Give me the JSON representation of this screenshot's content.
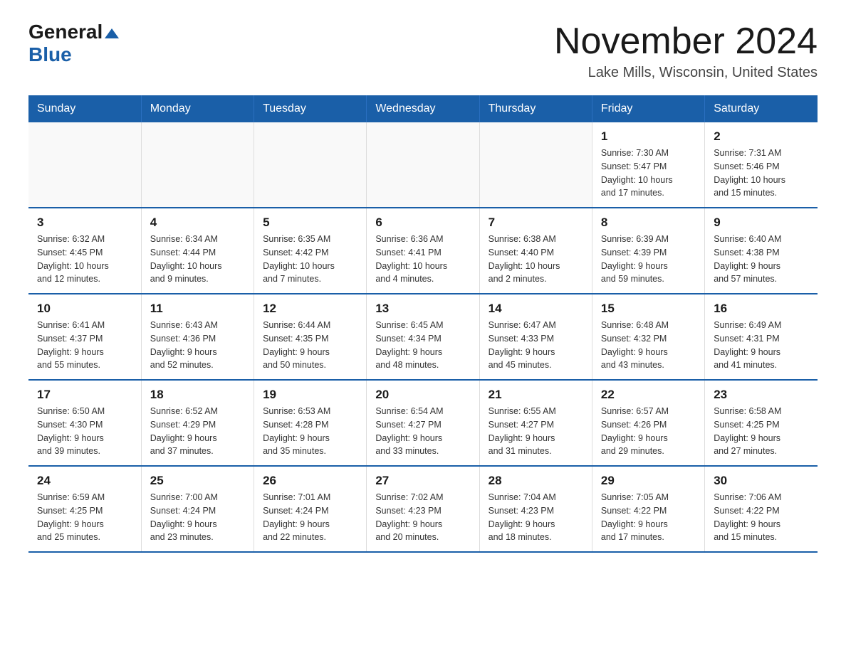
{
  "header": {
    "logo_general": "General",
    "logo_blue": "Blue",
    "month_title": "November 2024",
    "location": "Lake Mills, Wisconsin, United States"
  },
  "weekdays": [
    "Sunday",
    "Monday",
    "Tuesday",
    "Wednesday",
    "Thursday",
    "Friday",
    "Saturday"
  ],
  "weeks": [
    [
      {
        "day": "",
        "info": ""
      },
      {
        "day": "",
        "info": ""
      },
      {
        "day": "",
        "info": ""
      },
      {
        "day": "",
        "info": ""
      },
      {
        "day": "",
        "info": ""
      },
      {
        "day": "1",
        "info": "Sunrise: 7:30 AM\nSunset: 5:47 PM\nDaylight: 10 hours\nand 17 minutes."
      },
      {
        "day": "2",
        "info": "Sunrise: 7:31 AM\nSunset: 5:46 PM\nDaylight: 10 hours\nand 15 minutes."
      }
    ],
    [
      {
        "day": "3",
        "info": "Sunrise: 6:32 AM\nSunset: 4:45 PM\nDaylight: 10 hours\nand 12 minutes."
      },
      {
        "day": "4",
        "info": "Sunrise: 6:34 AM\nSunset: 4:44 PM\nDaylight: 10 hours\nand 9 minutes."
      },
      {
        "day": "5",
        "info": "Sunrise: 6:35 AM\nSunset: 4:42 PM\nDaylight: 10 hours\nand 7 minutes."
      },
      {
        "day": "6",
        "info": "Sunrise: 6:36 AM\nSunset: 4:41 PM\nDaylight: 10 hours\nand 4 minutes."
      },
      {
        "day": "7",
        "info": "Sunrise: 6:38 AM\nSunset: 4:40 PM\nDaylight: 10 hours\nand 2 minutes."
      },
      {
        "day": "8",
        "info": "Sunrise: 6:39 AM\nSunset: 4:39 PM\nDaylight: 9 hours\nand 59 minutes."
      },
      {
        "day": "9",
        "info": "Sunrise: 6:40 AM\nSunset: 4:38 PM\nDaylight: 9 hours\nand 57 minutes."
      }
    ],
    [
      {
        "day": "10",
        "info": "Sunrise: 6:41 AM\nSunset: 4:37 PM\nDaylight: 9 hours\nand 55 minutes."
      },
      {
        "day": "11",
        "info": "Sunrise: 6:43 AM\nSunset: 4:36 PM\nDaylight: 9 hours\nand 52 minutes."
      },
      {
        "day": "12",
        "info": "Sunrise: 6:44 AM\nSunset: 4:35 PM\nDaylight: 9 hours\nand 50 minutes."
      },
      {
        "day": "13",
        "info": "Sunrise: 6:45 AM\nSunset: 4:34 PM\nDaylight: 9 hours\nand 48 minutes."
      },
      {
        "day": "14",
        "info": "Sunrise: 6:47 AM\nSunset: 4:33 PM\nDaylight: 9 hours\nand 45 minutes."
      },
      {
        "day": "15",
        "info": "Sunrise: 6:48 AM\nSunset: 4:32 PM\nDaylight: 9 hours\nand 43 minutes."
      },
      {
        "day": "16",
        "info": "Sunrise: 6:49 AM\nSunset: 4:31 PM\nDaylight: 9 hours\nand 41 minutes."
      }
    ],
    [
      {
        "day": "17",
        "info": "Sunrise: 6:50 AM\nSunset: 4:30 PM\nDaylight: 9 hours\nand 39 minutes."
      },
      {
        "day": "18",
        "info": "Sunrise: 6:52 AM\nSunset: 4:29 PM\nDaylight: 9 hours\nand 37 minutes."
      },
      {
        "day": "19",
        "info": "Sunrise: 6:53 AM\nSunset: 4:28 PM\nDaylight: 9 hours\nand 35 minutes."
      },
      {
        "day": "20",
        "info": "Sunrise: 6:54 AM\nSunset: 4:27 PM\nDaylight: 9 hours\nand 33 minutes."
      },
      {
        "day": "21",
        "info": "Sunrise: 6:55 AM\nSunset: 4:27 PM\nDaylight: 9 hours\nand 31 minutes."
      },
      {
        "day": "22",
        "info": "Sunrise: 6:57 AM\nSunset: 4:26 PM\nDaylight: 9 hours\nand 29 minutes."
      },
      {
        "day": "23",
        "info": "Sunrise: 6:58 AM\nSunset: 4:25 PM\nDaylight: 9 hours\nand 27 minutes."
      }
    ],
    [
      {
        "day": "24",
        "info": "Sunrise: 6:59 AM\nSunset: 4:25 PM\nDaylight: 9 hours\nand 25 minutes."
      },
      {
        "day": "25",
        "info": "Sunrise: 7:00 AM\nSunset: 4:24 PM\nDaylight: 9 hours\nand 23 minutes."
      },
      {
        "day": "26",
        "info": "Sunrise: 7:01 AM\nSunset: 4:24 PM\nDaylight: 9 hours\nand 22 minutes."
      },
      {
        "day": "27",
        "info": "Sunrise: 7:02 AM\nSunset: 4:23 PM\nDaylight: 9 hours\nand 20 minutes."
      },
      {
        "day": "28",
        "info": "Sunrise: 7:04 AM\nSunset: 4:23 PM\nDaylight: 9 hours\nand 18 minutes."
      },
      {
        "day": "29",
        "info": "Sunrise: 7:05 AM\nSunset: 4:22 PM\nDaylight: 9 hours\nand 17 minutes."
      },
      {
        "day": "30",
        "info": "Sunrise: 7:06 AM\nSunset: 4:22 PM\nDaylight: 9 hours\nand 15 minutes."
      }
    ]
  ]
}
